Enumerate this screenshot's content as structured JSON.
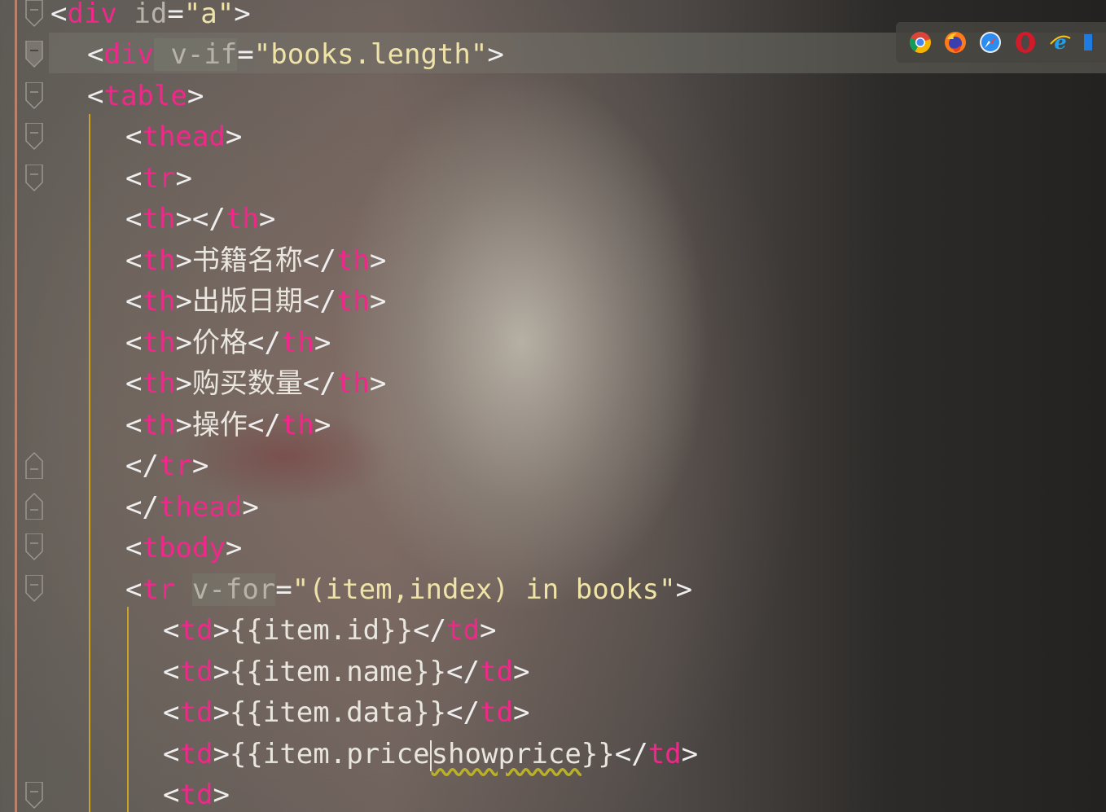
{
  "editor": {
    "lines": [
      {
        "p1": "<",
        "tag": "div",
        "gap": " ",
        "attr": "id",
        "eq": "=",
        "val": "\"a\"",
        "p2": ">"
      },
      {
        "p1": "<",
        "tag": "div",
        "gap": " ",
        "attr": "v-if",
        "eq": "=",
        "val": "\"books.length\"",
        "p2": ">"
      },
      {
        "p1": "<",
        "tag": "table",
        "p2": ">"
      },
      {
        "p1": "<",
        "tag": "thead",
        "p2": ">"
      },
      {
        "p1": "<",
        "tag": "tr",
        "p2": ">"
      },
      {
        "p1": "<",
        "tag": "th",
        "p2": "></",
        "tag2": "th",
        "p3": ">"
      },
      {
        "p1": "<",
        "tag": "th",
        "p2": ">",
        "text": "书籍名称",
        "p3": "</",
        "tag2": "th",
        "p4": ">"
      },
      {
        "p1": "<",
        "tag": "th",
        "p2": ">",
        "text": "出版日期",
        "p3": "</",
        "tag2": "th",
        "p4": ">"
      },
      {
        "p1": "<",
        "tag": "th",
        "p2": ">",
        "text": "价格",
        "p3": "</",
        "tag2": "th",
        "p4": ">"
      },
      {
        "p1": "<",
        "tag": "th",
        "p2": ">",
        "text": "购买数量",
        "p3": "</",
        "tag2": "th",
        "p4": ">"
      },
      {
        "p1": "<",
        "tag": "th",
        "p2": ">",
        "text": "操作",
        "p3": "</",
        "tag2": "th",
        "p4": ">"
      },
      {
        "p1": "</",
        "tag": "tr",
        "p2": ">"
      },
      {
        "p1": "</",
        "tag": "thead",
        "p2": ">"
      },
      {
        "p1": "<",
        "tag": "tbody",
        "p2": ">"
      },
      {
        "p1": "<",
        "tag": "tr",
        "gap": " ",
        "attr": "v-for",
        "eq": "=",
        "val": "\"(item,index) in books\"",
        "p2": ">"
      },
      {
        "p1": "<",
        "tag": "td",
        "p2": ">",
        "text": "{{item.id}}",
        "p3": "</",
        "tag2": "td",
        "p4": ">"
      },
      {
        "p1": "<",
        "tag": "td",
        "p2": ">",
        "text": "{{item.name}}",
        "p3": "</",
        "tag2": "td",
        "p4": ">"
      },
      {
        "p1": "<",
        "tag": "td",
        "p2": ">",
        "text": "{{item.data}}",
        "p3": "</",
        "tag2": "td",
        "p4": ">"
      },
      {
        "p1": "<",
        "tag": "td",
        "p2": ">",
        "textA": "{{item.price",
        "textB": "showprice",
        "textC": "}}",
        "p3": "</",
        "tag2": "td",
        "p4": ">"
      },
      {
        "p1": "<",
        "tag": "td",
        "p2": ">"
      }
    ]
  },
  "browser_bar": {
    "icons": [
      "chrome-icon",
      "firefox-icon",
      "safari-icon",
      "opera-icon",
      "ie-icon",
      "edge-icon"
    ]
  },
  "colors": {
    "tag": "#f0288a",
    "string": "#efe3a8",
    "attribute": "#b8b3a8",
    "text": "#e8e6df",
    "indent_guide": "#c9a227",
    "gutter_rail": "#c78a72"
  }
}
